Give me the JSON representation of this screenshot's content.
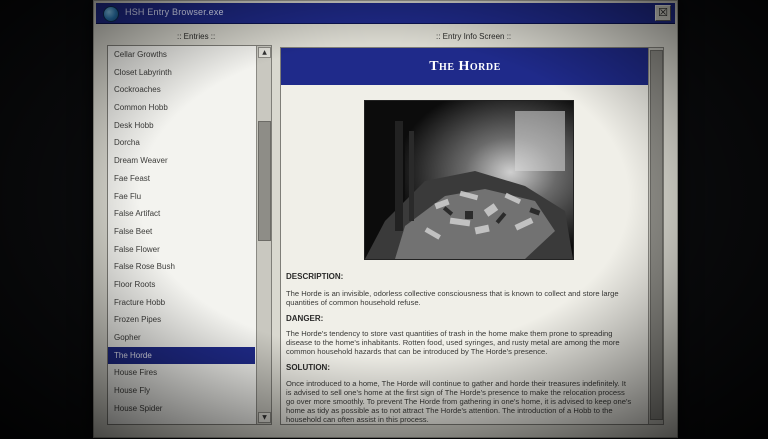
{
  "window": {
    "title": "HSH Entry Browser.exe",
    "close_glyph": "☒"
  },
  "panes": {
    "entries_label": ":: Entries ::",
    "info_label": ":: Entry Info Screen ::"
  },
  "list": {
    "items": [
      "Cellar Growths",
      "Closet Labyrinth",
      "Cockroaches",
      "Common Hobb",
      "Desk Hobb",
      "Dorcha",
      "Dream Weaver",
      "Fae Feast",
      "Fae Flu",
      "False Artifact",
      "False Beet",
      "False Flower",
      "False Rose Bush",
      "Floor Roots",
      "Fracture Hobb",
      "Frozen Pipes",
      "Gopher",
      "The Horde",
      "House Fires",
      "House Fly",
      "House Spider"
    ],
    "selected_index": 17,
    "scroll_up_glyph": "▲",
    "scroll_down_glyph": "▼"
  },
  "entry": {
    "title": "The Horde",
    "photo_icon": "photo-of-trash-pile",
    "description_heading": "DESCRIPTION:",
    "description": "The Horde is an invisible, odorless collective consciousness that is known to collect and store large quantities of common household refuse.",
    "danger_heading": "DANGER:",
    "danger": "The Horde's tendency to store vast quantities of trash in the home make them prone to spreading disease to the home's inhabitants. Rotten food, used syringes, and rusty metal are among the more common household hazards that can be introduced by The Horde's presence.",
    "solution_heading": "SOLUTION:",
    "solution": "Once introduced to a home, The Horde will continue to gather and horde their treasures indefinitely. It is advised to sell one's home at the first sign of The Horde's presence to make the relocation process go over more smoothly. To prevent The Horde from gathering in one's home, it is advised to keep one's home as tidy as possible as to not attract The Horde's attention. The introduction of a Hobb to the household can often assist in this process."
  },
  "colors": {
    "accent": "#1f2a8a",
    "window_bg": "#d9d8cf",
    "pane_bg": "#f0efe8"
  }
}
